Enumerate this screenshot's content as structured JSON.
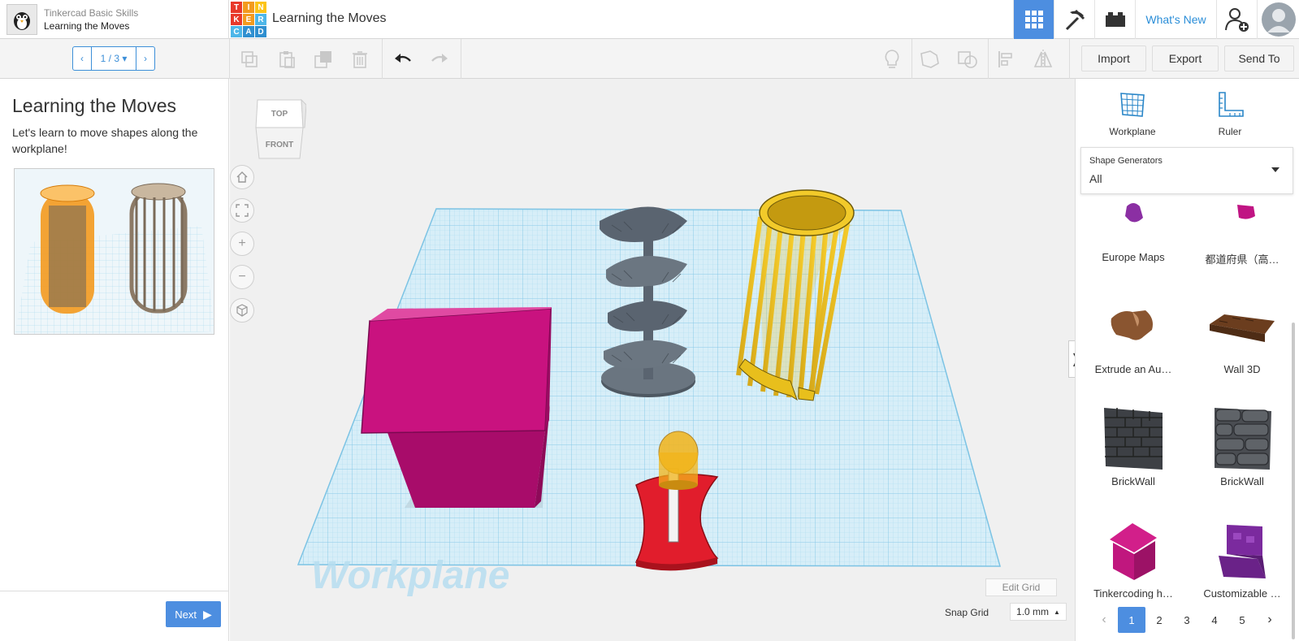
{
  "lesson": {
    "course": "Tinkercad Basic Skills",
    "name": "Learning the Moves"
  },
  "logo_letters": [
    "T",
    "I",
    "N",
    "K",
    "E",
    "R",
    "C",
    "A",
    "D"
  ],
  "design_title": "Learning the Moves",
  "topnav": {
    "whats_new": "What's New"
  },
  "pager": {
    "label": "1 / 3"
  },
  "actions": {
    "import": "Import",
    "export": "Export",
    "send_to": "Send To"
  },
  "left_panel": {
    "title": "Learning the Moves",
    "description": "Let's learn to move shapes along the workplane!",
    "next": "Next"
  },
  "canvas": {
    "cube_top": "TOP",
    "cube_front": "FRONT",
    "workplane_watermark": "Workplane",
    "edit_grid": "Edit Grid",
    "snap_grid_label": "Snap Grid",
    "snap_grid_value": "1.0 mm"
  },
  "right_panel": {
    "workplane": "Workplane",
    "ruler": "Ruler",
    "generators_label": "Shape Generators",
    "generators_value": "All",
    "shapes": [
      {
        "name": "Europe Maps",
        "color": "#8b2fa3"
      },
      {
        "name": "都道府県（高…",
        "color": "#c01483"
      },
      {
        "name": "Extrude an Au…",
        "color": "#8a5530"
      },
      {
        "name": "Wall 3D",
        "color": "#6b3d1e"
      },
      {
        "name": "BrickWall",
        "color": "#3d4045"
      },
      {
        "name": "BrickWall",
        "color": "#4a4d52"
      },
      {
        "name": "Tinkercoding h…",
        "color": "#c0177e"
      },
      {
        "name": "Customizable …",
        "color": "#7b2a9e"
      }
    ],
    "pages": [
      "1",
      "2",
      "3",
      "4",
      "5"
    ]
  },
  "colors": {
    "accent": "#4d8ee0",
    "grid": "#9fd3ec",
    "box": "#c4127c",
    "cage": "#e9c01a",
    "stair": "#5a6470",
    "bell": "#e31d2c"
  }
}
